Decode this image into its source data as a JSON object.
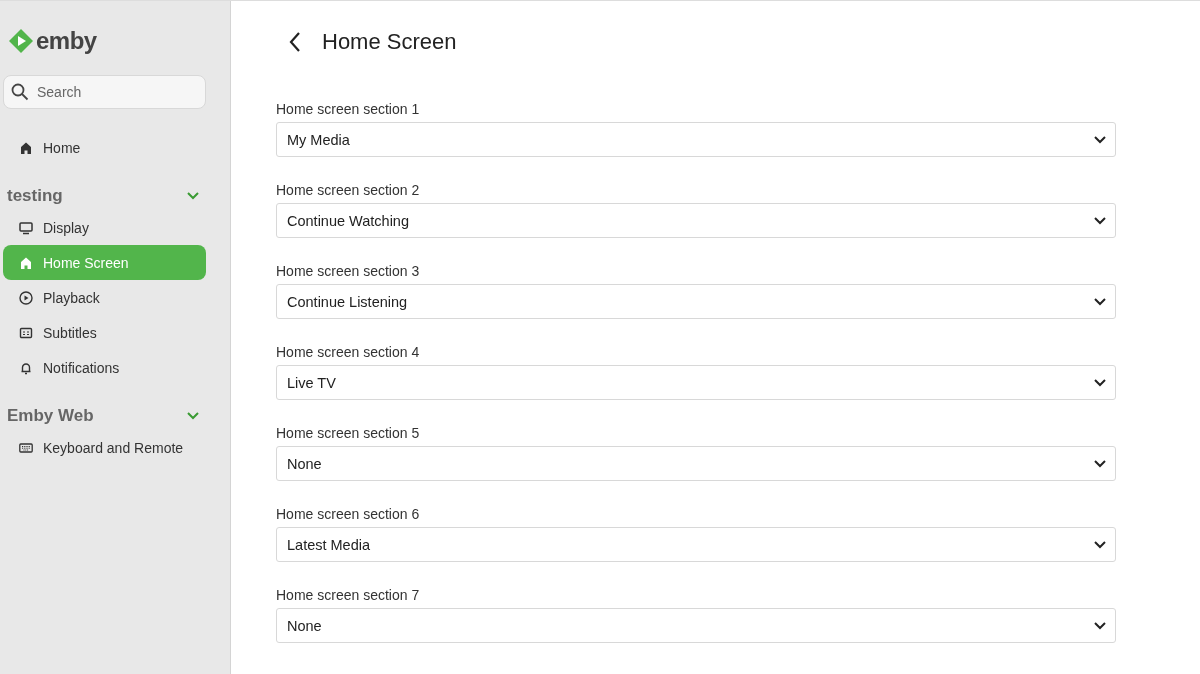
{
  "logo": {
    "text": "emby"
  },
  "search": {
    "placeholder": "Search"
  },
  "home_item": {
    "label": "Home",
    "selected": false
  },
  "groups": [
    {
      "title": "testing",
      "expanded": true,
      "items": [
        {
          "label": "Display",
          "kind": "display",
          "selected": false
        },
        {
          "label": "Home Screen",
          "kind": "home",
          "selected": true
        },
        {
          "label": "Playback",
          "kind": "playback",
          "selected": false
        },
        {
          "label": "Subtitles",
          "kind": "subtitles",
          "selected": false
        },
        {
          "label": "Notifications",
          "kind": "bell",
          "selected": false
        }
      ]
    },
    {
      "title": "Emby Web",
      "expanded": true,
      "items": [
        {
          "label": "Keyboard and Remote",
          "kind": "keyboard",
          "selected": false
        }
      ]
    }
  ],
  "page": {
    "title": "Home Screen"
  },
  "sections": [
    {
      "label": "Home screen section 1",
      "value": "My Media"
    },
    {
      "label": "Home screen section 2",
      "value": "Continue Watching"
    },
    {
      "label": "Home screen section 3",
      "value": "Continue Listening"
    },
    {
      "label": "Home screen section 4",
      "value": "Live TV"
    },
    {
      "label": "Home screen section 5",
      "value": "None"
    },
    {
      "label": "Home screen section 6",
      "value": "Latest Media"
    },
    {
      "label": "Home screen section 7",
      "value": "None"
    }
  ]
}
